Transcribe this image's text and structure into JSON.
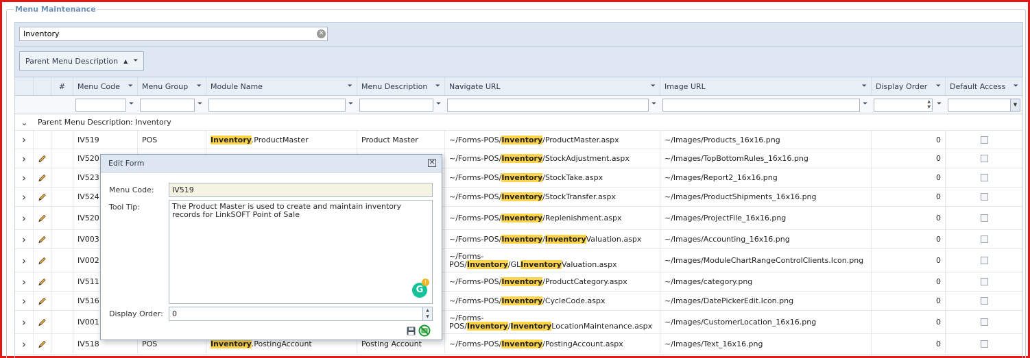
{
  "fieldset_title": "Menu Maintenance",
  "search": {
    "value": "Inventory"
  },
  "group_chip": {
    "label": "Parent Menu Description",
    "sort": "▲",
    "filter": "⏷"
  },
  "columns": {
    "num": "#",
    "menu_code": "Menu Code",
    "menu_group": "Menu Group",
    "module_name": "Module Name",
    "menu_description": "Menu Description",
    "navigate_url": "Navigate URL",
    "image_url": "Image URL",
    "display_order": "Display Order",
    "default_access": "Default Access"
  },
  "group_row": "Parent Menu Description: Inventory",
  "rows": [
    {
      "code": "IV519",
      "group": "POS",
      "module_hl": "Inventory",
      "module_rest": ".ProductMaster",
      "desc": "Product Master",
      "url_pre": "~/Forms-POS/",
      "url_hl": "Inventory",
      "url_post": "/ProductMaster.aspx",
      "image": "~/Images/Products_16x16.png",
      "order": "0",
      "pencil": false
    },
    {
      "code": "IV520",
      "url_pre": "~/Forms-POS/",
      "url_hl": "Inventory",
      "url_post": "/StockAdjustment.aspx",
      "image": "~/Images/TopBottomRules_16x16.png",
      "order": "0",
      "pencil": true
    },
    {
      "code": "IV523",
      "url_pre": "~/Forms-POS/",
      "url_hl": "Inventory",
      "url_post": "/StockTake.aspx",
      "image": "~/Images/Report2_16x16.png",
      "order": "0",
      "pencil": true
    },
    {
      "code": "IV524",
      "url_pre": "~/Forms-POS/",
      "url_hl": "Inventory",
      "url_post": "/StockTransfer.aspx",
      "image": "~/Images/ProductShipments_16x16.png",
      "order": "0",
      "pencil": true
    },
    {
      "code": "IV520",
      "url_pre": "~/Forms-POS/",
      "url_hl": "Inventory",
      "url_post": "/Replenishment.aspx",
      "image": "~/Images/ProjectFile_16x16.png",
      "order": "0",
      "pencil": true
    },
    {
      "code": "IV003",
      "url_pre": "~/Forms-POS/",
      "url_hl": "Inventory",
      "url_mid": "/",
      "url_hl2": "Inventory",
      "url_post": "Valuation.aspx",
      "image": "~/Images/Accounting_16x16.png",
      "order": "0",
      "pencil": true
    },
    {
      "code": "IV002",
      "url_line1": "~/Forms-",
      "url_pre": "POS/",
      "url_hl": "Inventory",
      "url_mid": "/GL",
      "url_hl2": "Inventory",
      "url_post": "Valuation.aspx",
      "image": "~/Images/ModuleChartRangeControlClients.Icon.png",
      "order": "0",
      "pencil": true
    },
    {
      "code": "IV511",
      "url_pre": "~/Forms-POS/",
      "url_hl": "Inventory",
      "url_post": "/ProductCategory.aspx",
      "image": "~/Images/category.png",
      "order": "0",
      "pencil": true
    },
    {
      "code": "IV516",
      "url_pre": "~/Forms-POS/",
      "url_hl": "Inventory",
      "url_post": "/CycleCode.aspx",
      "image": "~/Images/DatePickerEdit.Icon.png",
      "order": "0",
      "pencil": true
    },
    {
      "code": "IV001",
      "url_line1": "~/Forms-",
      "url_pre": "POS/",
      "url_hl": "Inventory",
      "url_mid": "/",
      "url_hl2": "Inventory",
      "url_post": "LocationMaintenance.aspx",
      "image": "~/Images/CustomerLocation_16x16.png",
      "order": "0",
      "pencil": true
    },
    {
      "code": "IV518",
      "group": "POS",
      "module_hl": "Inventory",
      "module_rest": ".PostingAccount",
      "desc": "Posting Account",
      "url_pre": "~/Forms-POS/",
      "url_hl": "Inventory",
      "url_post": "/PostingAccount.aspx",
      "image": "~/Images/Text_16x16.png",
      "order": "0",
      "pencil": true
    }
  ],
  "edit_form": {
    "title": "Edit Form",
    "menu_code_label": "Menu Code:",
    "menu_code_value": "IV519",
    "tooltip_label": "Tool Tip:",
    "tooltip_value": "The Product Master is used to create and maintain inventory records for LinkSOFT Point of Sale",
    "display_order_label": "Display Order:",
    "display_order_value": "0"
  },
  "colors": {
    "highlight": "#ffd34a",
    "header_bg": "#e8eef5",
    "frame": "#e01818"
  }
}
